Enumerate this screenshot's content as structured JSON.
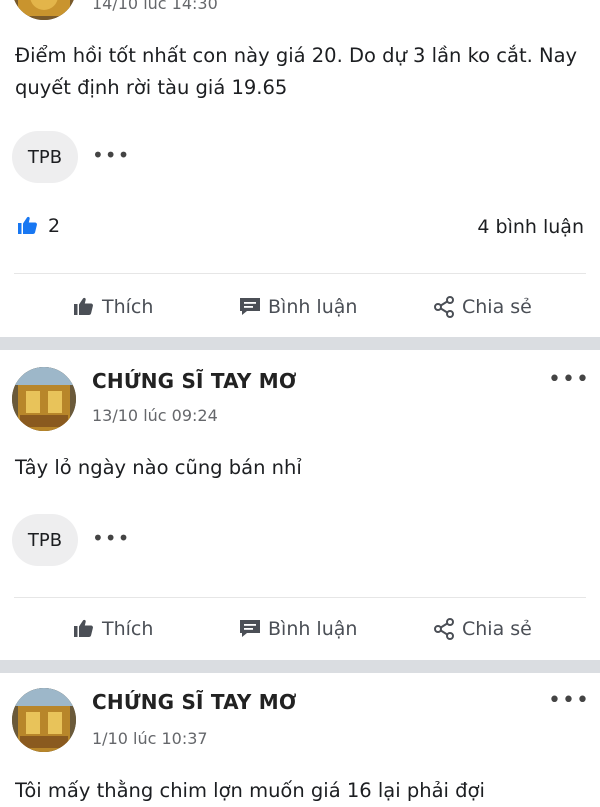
{
  "colors": {
    "like_blue": "#1877f2",
    "separator": "#dadde1",
    "muted_text": "#65676b"
  },
  "icons": {
    "like": "thumbs-up-icon",
    "comment": "comment-bubble-icon",
    "share": "share-icon",
    "more": "more-dots-icon"
  },
  "posts": [
    {
      "time": "14/10 lúc 14:30",
      "text": "Điểm hồi tốt nhất con này giá 20. Do dự 3 lần ko cắt. Nay quyết định rời tàu giá 19.65",
      "tag": "TPB",
      "tag_more": "•••",
      "reactions": {
        "count": "2"
      },
      "comment_count": "4 bình luận",
      "actions": {
        "like": "Thích",
        "comment": "Bình luận",
        "share": "Chia sẻ"
      }
    },
    {
      "author": "CHỨNG SĨ TAY MƠ",
      "time": "13/10 lúc 09:24",
      "more": "•••",
      "text": "Tây lỏ ngày nào cũng bán nhỉ",
      "tag": "TPB",
      "tag_more": "•••",
      "actions": {
        "like": "Thích",
        "comment": "Bình luận",
        "share": "Chia sẻ"
      }
    },
    {
      "author": "CHỨNG SĨ TAY MƠ",
      "time": "1/10 lúc 10:37",
      "more": "•••",
      "text": "Tôi mấy thằng chim lợn muốn giá 16 lại phải đợi"
    }
  ]
}
